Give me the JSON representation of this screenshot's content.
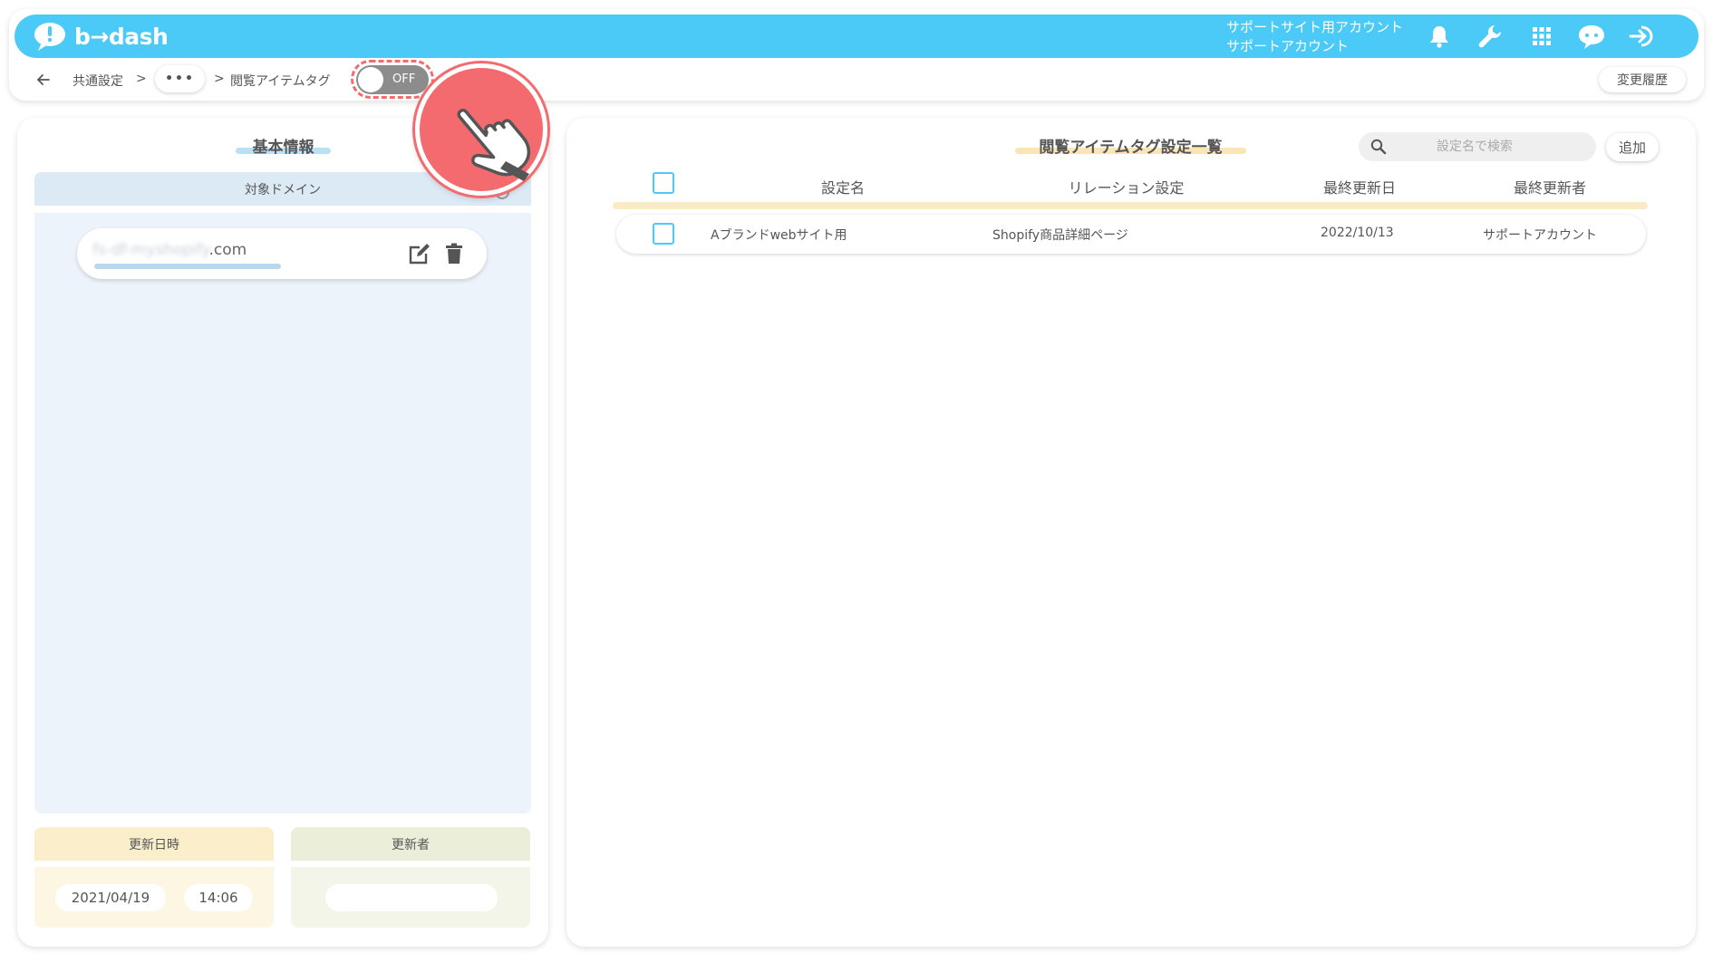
{
  "header": {
    "logo_text": "b→dash",
    "account_line1": "サポートサイト用アカウント",
    "account_line2": "サポートアカウント",
    "icons": [
      "bell-icon",
      "wrench-icon",
      "apps-grid-icon",
      "support-chat-icon",
      "logout-icon"
    ],
    "brand_color": "#4ccaf7"
  },
  "breadcrumb": {
    "items": [
      "共通設定",
      "•••",
      "閲覧アイテムタグ"
    ],
    "separator": ">",
    "toggle_label": "OFF",
    "toggle_on": false,
    "history_button": "変更履歴"
  },
  "left_panel": {
    "title": "基本情報",
    "domain_header": "対象ドメイン",
    "domain_value_hidden": "fs-df-myshopify",
    "domain_value_suffix": ".com",
    "updated_at_header": "更新日時",
    "updated_date": "2021/04/19",
    "updated_time": "14:06",
    "updated_by_header": "更新者",
    "updated_by_value": ""
  },
  "right_panel": {
    "title": "閲覧アイテムタグ設定一覧",
    "search_placeholder": "設定名で検索",
    "add_button": "追加",
    "columns": [
      "設定名",
      "リレーション設定",
      "最終更新日",
      "最終更新者"
    ],
    "rows": [
      {
        "name": "Aブランドwebサイト用",
        "relation": "Shopify商品詳細ページ",
        "updated": "2022/10/13",
        "updated_by": "サポートアカウント"
      }
    ]
  },
  "colors": {
    "accent_blue": "#4ccaf7",
    "highlight_red": "#f36b6f",
    "panel_blue": "#ecf3fb",
    "panel_yellow": "#fdf6e3",
    "panel_green": "#f4f5e9"
  }
}
